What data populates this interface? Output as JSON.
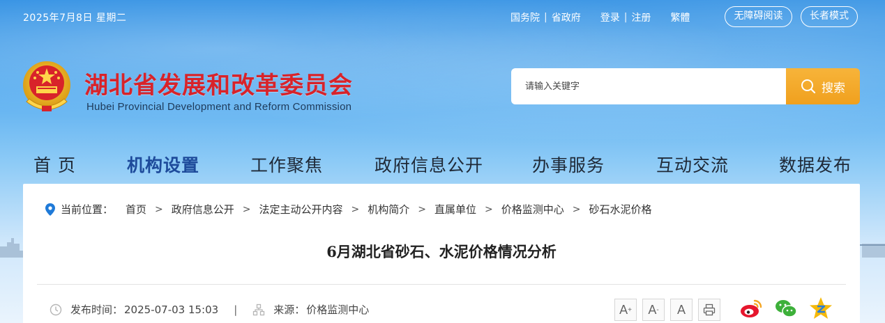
{
  "topbar": {
    "date": "2025年7月8日 星期二",
    "links": [
      "国务院",
      "省政府"
    ],
    "auth": [
      "登录",
      "注册"
    ],
    "traditional": "繁體",
    "accessibility": "无障碍阅读",
    "elder_mode": "长者模式"
  },
  "header": {
    "title": "湖北省发展和改革委员会",
    "subtitle": "Hubei Provincial Development and Reform Commission"
  },
  "search": {
    "placeholder": "请输入关键字",
    "button": "搜索"
  },
  "nav": [
    "首 页",
    "机构设置",
    "工作聚焦",
    "政府信息公开",
    "办事服务",
    "互动交流",
    "数据发布"
  ],
  "breadcrumb": {
    "label": "当前位置：",
    "items": [
      "首页",
      "政府信息公开",
      "法定主动公开内容",
      "机构简介",
      "直属单位",
      "价格监测中心",
      "砂石水泥价格"
    ]
  },
  "article": {
    "title": "6月湖北省砂石、水泥价格情况分析",
    "publish_label": "发布时间：",
    "publish_time": "2025-07-03 15:03",
    "source_label": "来源：",
    "source": "价格监测中心"
  },
  "colors": {
    "title_red": "#d8232a",
    "nav_active": "#1e4b9b",
    "search_orange": "#f0a01e"
  }
}
